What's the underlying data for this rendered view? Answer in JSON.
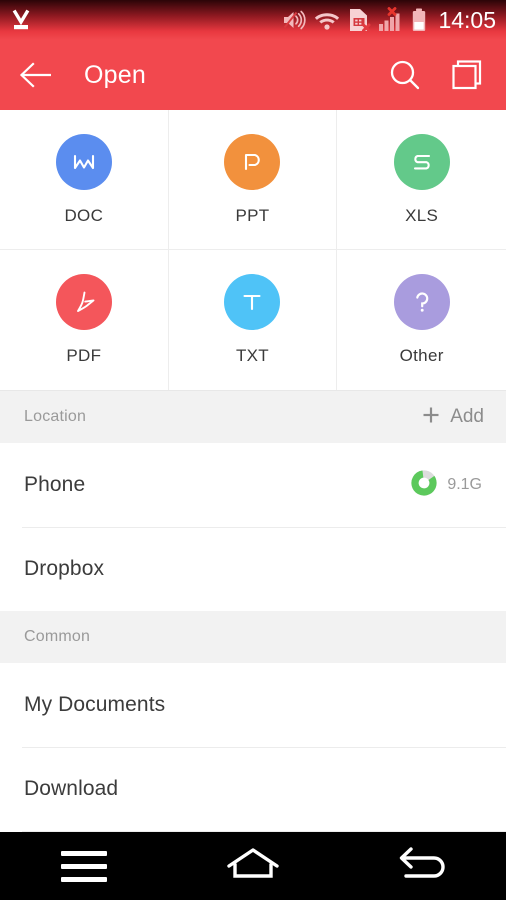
{
  "statusbar": {
    "time": "14:05",
    "icons": [
      {
        "name": "download-icon",
        "position": "left"
      },
      {
        "name": "volume-muted-icon",
        "position": "right"
      },
      {
        "name": "wifi-icon",
        "position": "right"
      },
      {
        "name": "sim-card-error-icon",
        "position": "right"
      },
      {
        "name": "signal-bars-no-service-icon",
        "position": "right"
      },
      {
        "name": "battery-icon",
        "position": "right"
      }
    ]
  },
  "appbar": {
    "back_label": "back-arrow",
    "title": "Open",
    "actions": [
      {
        "name": "search-icon",
        "label": "Search"
      },
      {
        "name": "copy-layers-icon",
        "label": "Windows"
      }
    ],
    "background": "#f2484e"
  },
  "filetypes": [
    {
      "label": "DOC",
      "glyph": "W",
      "color": "#5b8def"
    },
    {
      "label": "PPT",
      "glyph": "P",
      "color": "#f2913d"
    },
    {
      "label": "XLS",
      "glyph": "S",
      "color": "#63c98a"
    },
    {
      "label": "PDF",
      "glyph": "A",
      "color": "#f4565b"
    },
    {
      "label": "TXT",
      "glyph": "T",
      "color": "#4fc3f7"
    },
    {
      "label": "Other",
      "glyph": "?",
      "color": "#a99cde"
    }
  ],
  "sections": [
    {
      "title": "Location",
      "action": {
        "label": "Add",
        "icon": "plus-icon"
      },
      "rows": [
        {
          "label": "Phone",
          "meta": "9.1G",
          "storage_used_percent": 82,
          "ring_color": "#5cc95c",
          "ring_track": "#dcdcdc"
        },
        {
          "label": "Dropbox",
          "meta": "",
          "storage_used_percent": null
        }
      ]
    },
    {
      "title": "Common",
      "action": null,
      "rows": [
        {
          "label": "My Documents",
          "meta": "",
          "storage_used_percent": null
        },
        {
          "label": "Download",
          "meta": "",
          "storage_used_percent": null
        }
      ]
    }
  ],
  "navbar": {
    "buttons": [
      {
        "name": "menu-button",
        "icon": "hamburger-menu-icon"
      },
      {
        "name": "home-button",
        "icon": "home-icon"
      },
      {
        "name": "back-button",
        "icon": "back-arrow-icon"
      }
    ]
  }
}
